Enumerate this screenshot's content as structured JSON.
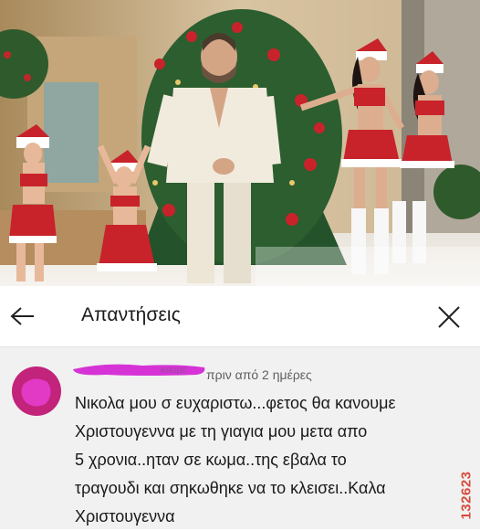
{
  "header": {
    "title": "Απαντήσεις",
    "back_icon": "arrow-left-icon",
    "close_icon": "close-icon"
  },
  "comment": {
    "timestamp": "πριν από 2 ημέρες",
    "lines": [
      "Νικολα μου σ ευχαριστω...φετος θα κανουμε",
      "Χριστουγεννα με τη γιαγια μου μετα απο",
      "5 χρονια..ηταν σε κωμα..της εβαλα το",
      "τραγουδι και σηκωθηκε να το κλεισει..Καλα",
      "Χριστουγεννα"
    ],
    "avatar_color": "#c2237b",
    "redaction_color": "#d633d6"
  },
  "watermark": {
    "text": "132623",
    "color": "#d84a3c"
  }
}
